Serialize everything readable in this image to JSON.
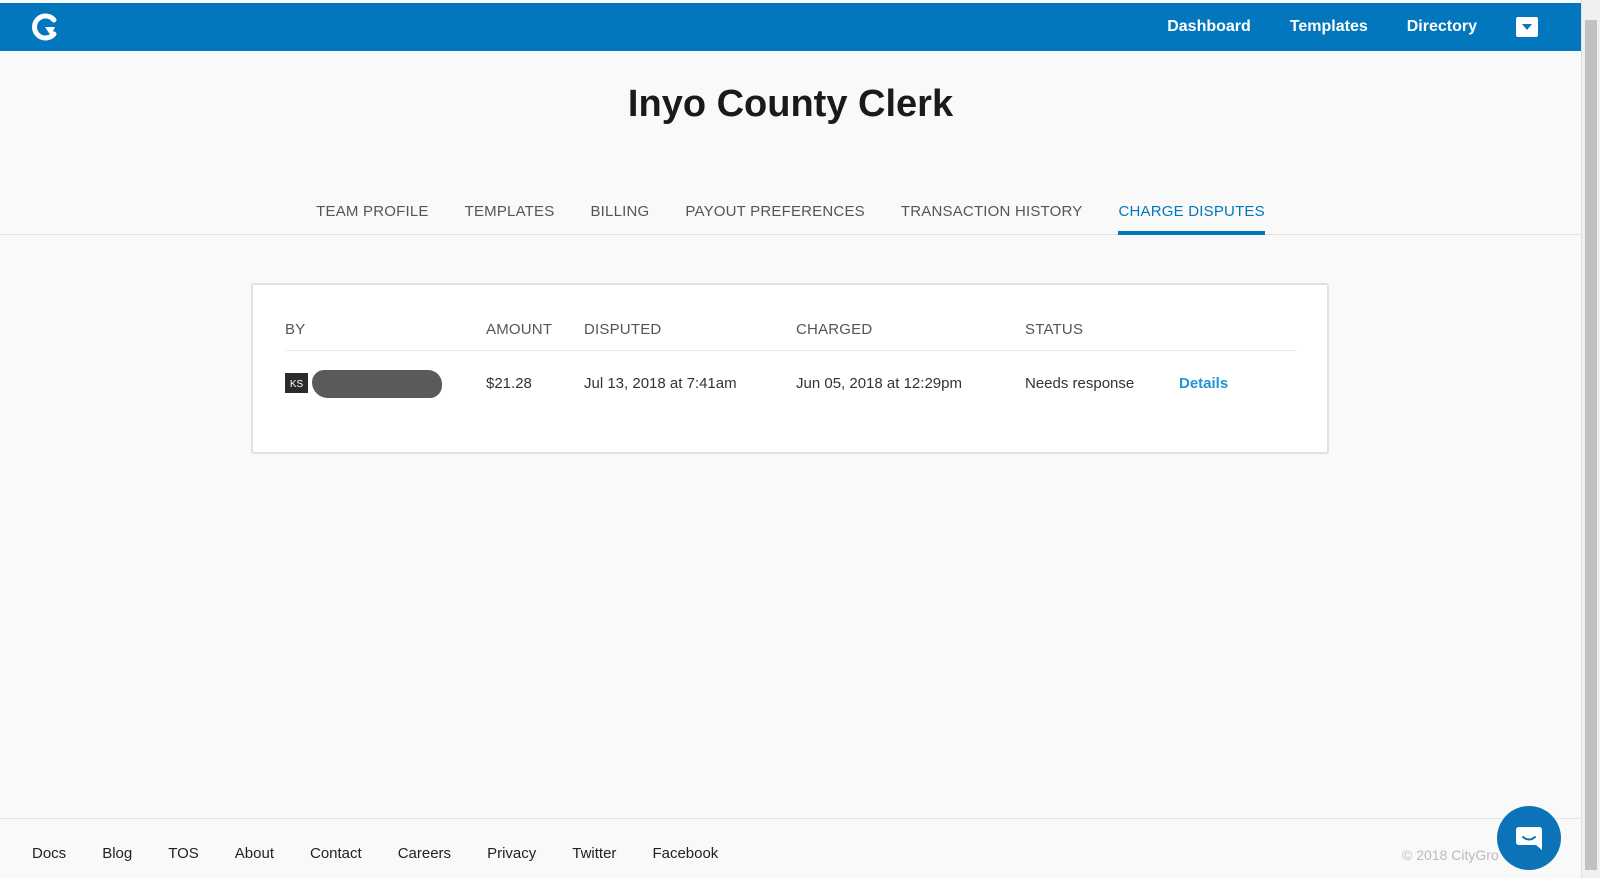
{
  "topbar": {
    "nav": [
      {
        "label": "Dashboard"
      },
      {
        "label": "Templates"
      },
      {
        "label": "Directory"
      }
    ]
  },
  "page": {
    "title": "Inyo County Clerk"
  },
  "tabs": [
    {
      "label": "TEAM PROFILE",
      "active": false
    },
    {
      "label": "TEMPLATES",
      "active": false
    },
    {
      "label": "BILLING",
      "active": false
    },
    {
      "label": "PAYOUT PREFERENCES",
      "active": false
    },
    {
      "label": "TRANSACTION HISTORY",
      "active": false
    },
    {
      "label": "CHARGE DISPUTES",
      "active": true
    }
  ],
  "disputes": {
    "columns": [
      "BY",
      "AMOUNT",
      "DISPUTED",
      "CHARGED",
      "STATUS"
    ],
    "rows": [
      {
        "initials": "KS",
        "amount": "$21.28",
        "disputed": "Jul 13, 2018 at 7:41am",
        "charged": "Jun 05, 2018 at 12:29pm",
        "status": "Needs response",
        "action": "Details"
      }
    ]
  },
  "footer": {
    "links": [
      "Docs",
      "Blog",
      "TOS",
      "About",
      "Contact",
      "Careers",
      "Privacy",
      "Twitter",
      "Facebook"
    ],
    "copyright": "© 2018 CityGro"
  },
  "colors": {
    "brand": "#0277bd",
    "link": "#2196d3",
    "background": "#f9f9f9"
  },
  "icons": {
    "logo": "citygro-logo-icon",
    "dropdown": "chevron-down-icon",
    "chat": "chat-bubble-icon"
  }
}
